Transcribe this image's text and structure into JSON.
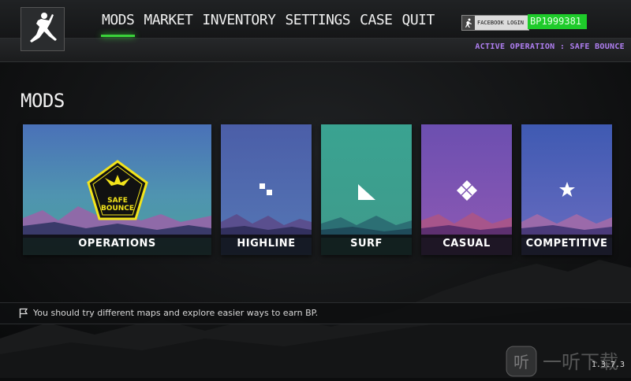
{
  "nav": {
    "items": [
      {
        "label": "MODS",
        "active": true
      },
      {
        "label": "MARKET"
      },
      {
        "label": "INVENTORY"
      },
      {
        "label": "SETTINGS"
      },
      {
        "label": "CASE"
      },
      {
        "label": "QUIT"
      }
    ]
  },
  "account": {
    "facebook_label": "FACEBOOK LOGIN",
    "bp": "BP1999381"
  },
  "active_operation": "ACTIVE OPERATION : SAFE BOUNCE",
  "page_title": "MODS",
  "cards": [
    {
      "label": "OPERATIONS",
      "badge_text_1": "SAFE",
      "badge_text_2": "BOUNCE",
      "icon": "safe-bounce-badge-icon"
    },
    {
      "label": "HIGHLINE",
      "icon": "highline-icon"
    },
    {
      "label": "SURF",
      "icon": "surf-icon"
    },
    {
      "label": "CASUAL",
      "icon": "casual-icon"
    },
    {
      "label": "COMPETITIVE",
      "icon": "star-icon"
    }
  ],
  "tip": "You should try different maps and explore easier ways to earn BP.",
  "version": "1.3.7.3",
  "watermark": {
    "glyph": "听",
    "text": "一听下载"
  },
  "colors": {
    "accent_green": "#3ad13a",
    "bp_green": "#1ecb2a",
    "operation_purple": "#b07ff2",
    "badge_yellow": "#f3e41b"
  }
}
